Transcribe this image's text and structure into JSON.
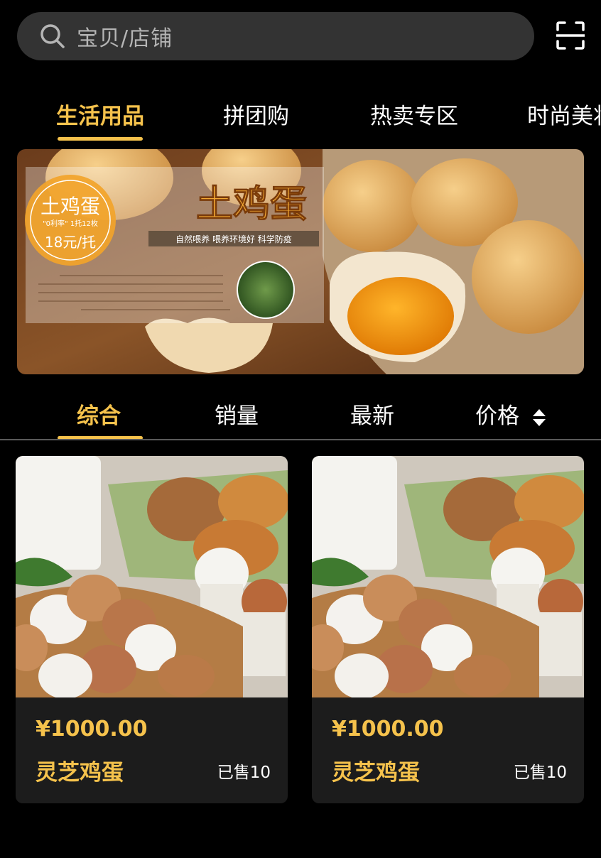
{
  "search": {
    "placeholder": "宝贝/店铺",
    "icon": "search-icon"
  },
  "scan_icon": "scan-icon",
  "category_tabs": [
    {
      "label": "生活用品",
      "active": true
    },
    {
      "label": "拼团购",
      "active": false
    },
    {
      "label": "热卖专区",
      "active": false
    },
    {
      "label": "时尚美妆",
      "active": false
    }
  ],
  "banner": {
    "title": "土鸡蛋",
    "badge_title": "土鸡蛋",
    "badge_sub": "\"0利率\" 1托12枚",
    "badge_price": "18元/托",
    "slogan": "自然喂养  喂养环境好  科学防疫"
  },
  "sort_tabs": [
    {
      "label": "综合",
      "active": true
    },
    {
      "label": "销量",
      "active": false
    },
    {
      "label": "最新",
      "active": false
    },
    {
      "label": "价格",
      "active": false,
      "icon": "sort-arrows-icon"
    }
  ],
  "products": [
    {
      "price": "¥1000.00",
      "name": "灵芝鸡蛋",
      "sold": "已售10"
    },
    {
      "price": "¥1000.00",
      "name": "灵芝鸡蛋",
      "sold": "已售10"
    }
  ],
  "colors": {
    "accent": "#f5c24c",
    "background": "#000000",
    "card": "#1c1c1c",
    "search_bg": "#333333"
  }
}
